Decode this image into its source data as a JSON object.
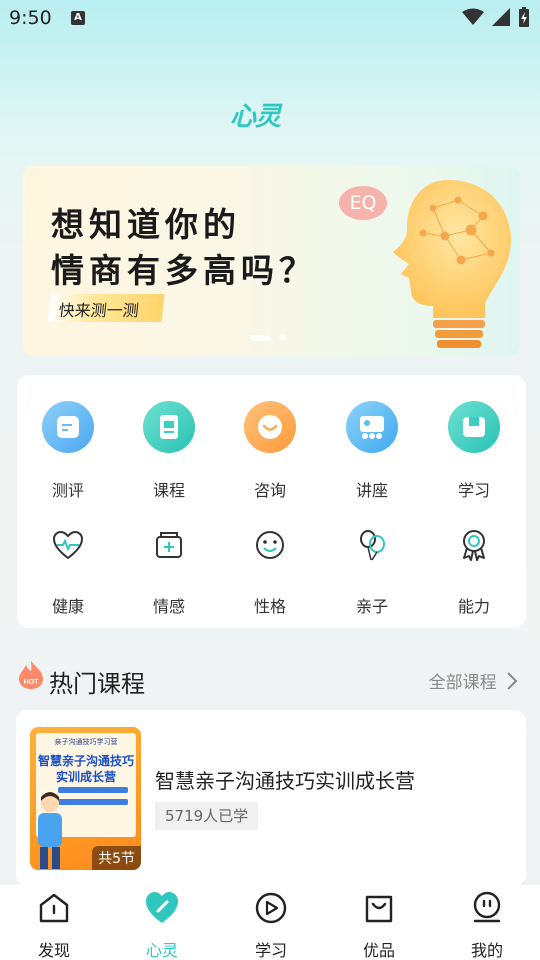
{
  "status": {
    "time": "9:50",
    "a_icon": "A"
  },
  "app": {
    "logo": "心灵"
  },
  "banner": {
    "title_line1": "想知道你的",
    "title_line2": "情商有多高吗？",
    "tag": "快来测一测",
    "badge": "EQ",
    "slides": 2,
    "active_slide": 1
  },
  "categories_primary": [
    {
      "label": "测评",
      "icon": "assessment-icon",
      "color": "#6bb6f3"
    },
    {
      "label": "课程",
      "icon": "course-icon",
      "color": "#3ccfc1"
    },
    {
      "label": "咨询",
      "icon": "consult-icon",
      "color": "#ffaa55"
    },
    {
      "label": "讲座",
      "icon": "lecture-icon",
      "color": "#5dbcf5"
    },
    {
      "label": "学习",
      "icon": "study-icon",
      "color": "#3ccfc1"
    }
  ],
  "categories_secondary": [
    {
      "label": "健康",
      "icon": "heart-pulse-icon"
    },
    {
      "label": "情感",
      "icon": "emotion-box-icon"
    },
    {
      "label": "性格",
      "icon": "smile-face-icon"
    },
    {
      "label": "亲子",
      "icon": "balloons-icon"
    },
    {
      "label": "能力",
      "icon": "award-medal-icon"
    }
  ],
  "hot": {
    "badge": "HOT",
    "title": "热门课程",
    "all_label": "全部课程"
  },
  "course": {
    "title": "智慧亲子沟通技巧实训成长营",
    "learners": "5719人已学",
    "lessons": "共5节",
    "thumb_header": "亲子沟通技巧学习营",
    "thumb_title_1": "智慧亲子沟通技巧",
    "thumb_title_2": "实训成长营"
  },
  "nav": [
    {
      "label": "发现",
      "icon": "home-icon",
      "active": false
    },
    {
      "label": "心灵",
      "icon": "heart-pen-icon",
      "active": true
    },
    {
      "label": "学习",
      "icon": "play-circle-icon",
      "active": false
    },
    {
      "label": "优品",
      "icon": "shopping-bag-icon",
      "active": false
    },
    {
      "label": "我的",
      "icon": "profile-icon",
      "active": false
    }
  ],
  "colors": {
    "accent": "#2fc7bf",
    "nav_inactive": "#222222"
  }
}
